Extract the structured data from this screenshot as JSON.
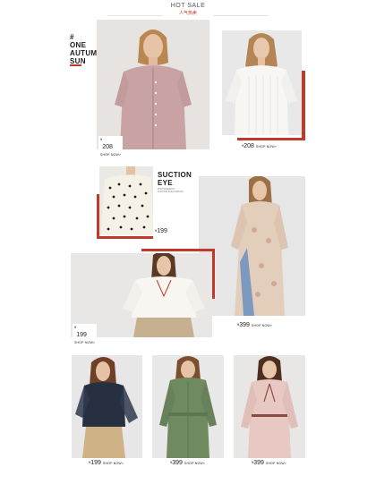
{
  "header": {
    "title": "HOT SALE",
    "subtitle": "人气热卖"
  },
  "section1": {
    "hash": "#",
    "title_lines": [
      "ONE",
      "AUTUMN",
      "SUN"
    ]
  },
  "section2": {
    "hash": "#",
    "title_lines": [
      "SUCTION",
      "EYE"
    ],
    "caption_lines": [
      "PHOTOGRAPHY",
      "SUCTION EYE FASHION"
    ]
  },
  "products": [
    {
      "price": "208",
      "currency": "¥",
      "shop": "SHOP NOW>"
    },
    {
      "price": "208",
      "currency": "¥",
      "shop": "SHOP NOW>"
    },
    {
      "price": "199",
      "currency": "¥",
      "shop": ""
    },
    {
      "price": "399",
      "currency": "¥",
      "shop": "SHOP NOW>"
    },
    {
      "price": "199",
      "currency": "¥",
      "shop": "SHOP NOW>"
    },
    {
      "price": "199",
      "currency": "¥",
      "shop": "SHOP NOW>"
    },
    {
      "price": "399",
      "currency": "¥",
      "shop": "SHOP NOW>"
    },
    {
      "price": "399",
      "currency": "¥",
      "shop": "SHOP NOW>"
    }
  ],
  "photos": [
    {
      "icon": "model-tweed-jacket-photo"
    },
    {
      "icon": "model-white-knit-top-photo"
    },
    {
      "icon": "polka-dot-blouse-photo"
    },
    {
      "icon": "model-floral-maxi-dress-photo"
    },
    {
      "icon": "model-white-blouse-photo"
    },
    {
      "icon": "model-sheer-navy-blouse-photo"
    },
    {
      "icon": "model-green-shirt-dress-photo"
    },
    {
      "icon": "model-pink-bow-dress-photo"
    }
  ],
  "colors": {
    "accent": "#c0392b",
    "photo_bg": "#ececec"
  }
}
